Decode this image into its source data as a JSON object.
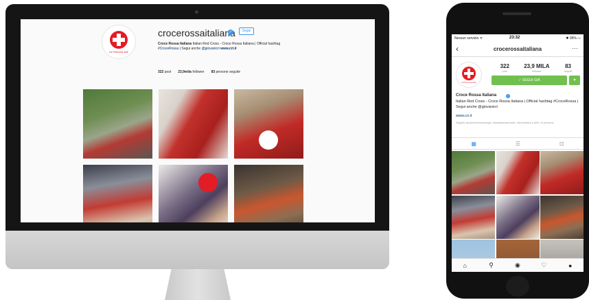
{
  "desktop": {
    "username": "crocerossaitaliana",
    "verified_badge": "✓",
    "follow_label": "Segui",
    "logo_text": "La Potenza dell'",
    "bio_name": "Croce Rossa Italiana",
    "bio_text": "Italian Red Cross - Croce Rossa Italiana | Official hashtag",
    "bio_line2_tag": "#CroceRossa",
    "bio_line2_text": "| Segui anche",
    "bio_handle": "@giovanicri",
    "bio_link": "www.cri.it",
    "stats": [
      {
        "num": "322",
        "label": "post"
      },
      {
        "num": "23,9mila",
        "label": "follower"
      },
      {
        "num": "83",
        "label": "persone seguite"
      }
    ]
  },
  "phone": {
    "status": {
      "carrier": "Nessun servizio ᯤ",
      "clock": "23:32",
      "battery": "✱ 95% ▭"
    },
    "nav_title": "crocerossaitaliana",
    "back_icon": "‹",
    "more_icon": "···",
    "logo_text": "La Potenza dell'",
    "stats": [
      {
        "num": "322",
        "label": "post"
      },
      {
        "num": "23,9 MILA",
        "label": "follower"
      },
      {
        "num": "83",
        "label": "seguiti"
      }
    ],
    "follow_label": "✓ SEGUI GIÀ",
    "dropdown_icon": "▾",
    "name": "Croce Rossa Italiana",
    "verified_badge": "✓",
    "bio": "Italian Red Cross - Croce Rossa Italiana | Official hashtag #CroceRossa | Segui anche @giovanicri",
    "link": "www.cri.it",
    "followed_by": "Seguito da jimmorrisonmagic, klaudialamaronotti, robertofalza e altre 11 persone",
    "tabs": {
      "grid": "▦",
      "list": "☰",
      "tagged": "⊡"
    },
    "bottom_icons": {
      "home": "⌂",
      "search": "⚲",
      "camera": "◉",
      "heart": "♡",
      "profile": "●"
    }
  },
  "colors": {
    "brand_red": "#e21d25",
    "link_blue": "#3897f0",
    "follow_green": "#70c050"
  }
}
